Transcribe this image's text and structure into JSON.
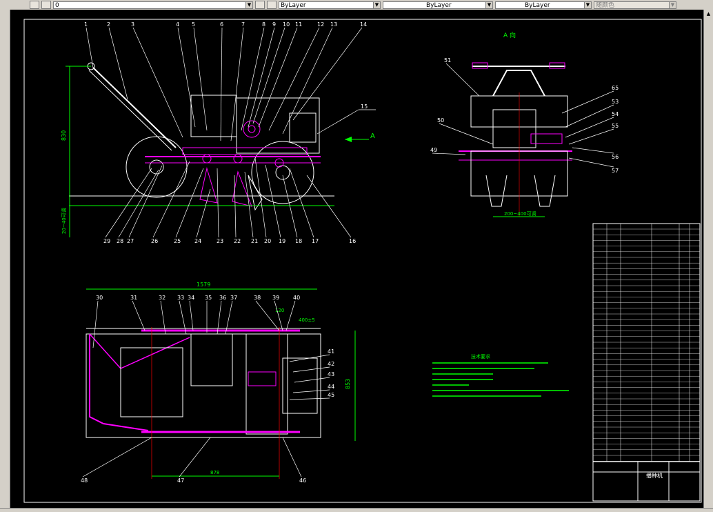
{
  "toolbar": {
    "layer_value": "0",
    "color_value": "ByLayer",
    "linetype_value": "ByLayer",
    "lineweight_value": "ByLayer",
    "plotstyle_value": "随颜色"
  },
  "drawing": {
    "section_label": "A",
    "view_label": "A 向",
    "side_view": {
      "callouts_top": [
        "1",
        "2",
        "3",
        "4",
        "5",
        "6",
        "7",
        "8",
        "9",
        "10",
        "11",
        "12",
        "13",
        "14"
      ],
      "callouts_bottom": [
        "29",
        "28",
        "27",
        "26",
        "25",
        "24",
        "23",
        "22",
        "21",
        "20",
        "19",
        "18",
        "17",
        "16"
      ],
      "callout_15": "15",
      "dim_height": "830",
      "dim_depth": "20~40可调"
    },
    "end_view": {
      "callouts_left": [
        "51",
        "50",
        "49"
      ],
      "callouts_right": [
        "65",
        "53",
        "54",
        "55",
        "56",
        "57"
      ],
      "dim_width": "200~400可调"
    },
    "plan_view": {
      "callouts_top": [
        "30",
        "31",
        "32",
        "33",
        "34",
        "35",
        "36",
        "37",
        "38",
        "39",
        "40"
      ],
      "callouts_right": [
        "41",
        "42",
        "43",
        "44",
        "45"
      ],
      "callouts_bottom": [
        "48",
        "47",
        "46"
      ],
      "dim_length": "1579",
      "dim_width": "853",
      "dim_track": "878",
      "dim_small": "120",
      "dim_spacing": "400±5"
    },
    "notes_title": "技术要求",
    "title_block_name": "播种机"
  },
  "colors": {
    "background": "#000000",
    "outline": "#ffffff",
    "dimension": "#00ff00",
    "part": "#ff00ff",
    "center": "#ff0000",
    "accent": "#00ffff"
  }
}
